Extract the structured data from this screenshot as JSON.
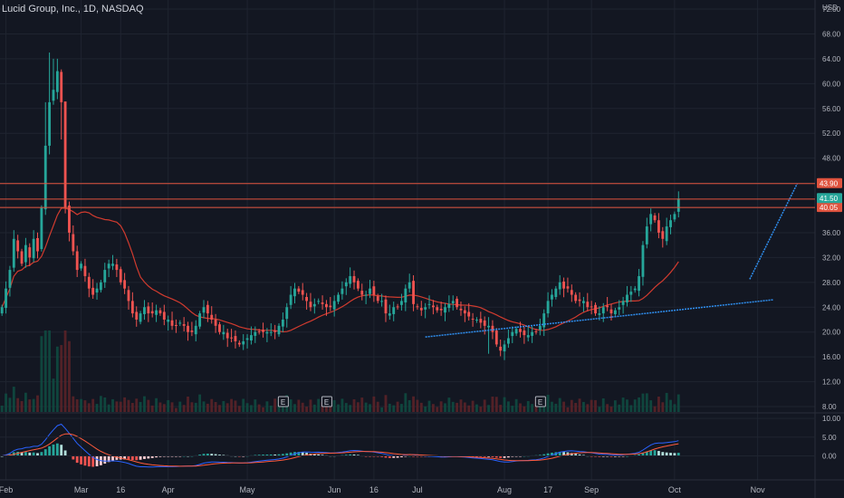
{
  "header": {
    "title": "Lucid Group, Inc., 1D, NASDAQ",
    "currency": "USD"
  },
  "colors": {
    "background": "#131722",
    "grid": "#1f2430",
    "up": "#26a69a",
    "down": "#ef5350",
    "ma": "#d13b2f",
    "trendline": "#2f8ff0",
    "hline": "#e0533e",
    "macd": "#2962ff",
    "signal": "#ff5a3c"
  },
  "chart_data": [
    {
      "type": "candlestick",
      "title": "Lucid Group, Inc., 1D, NASDAQ",
      "ylabel": "USD",
      "ylim": [
        8,
        72
      ],
      "yticks": [
        "72.00",
        "68.00",
        "64.00",
        "60.00",
        "56.00",
        "52.00",
        "48.00",
        "44.00",
        "40.00",
        "36.00",
        "32.00",
        "28.00",
        "24.00",
        "20.00",
        "16.00",
        "12.00",
        "8.00"
      ],
      "xticks": [
        {
          "label": "Feb",
          "x": 1
        },
        {
          "label": "Mar",
          "x": 20
        },
        {
          "label": "16",
          "x": 30
        },
        {
          "label": "Apr",
          "x": 42
        },
        {
          "label": "May",
          "x": 62
        },
        {
          "label": "Jun",
          "x": 84
        },
        {
          "label": "16",
          "x": 94
        },
        {
          "label": "Jul",
          "x": 105
        },
        {
          "label": "Aug",
          "x": 127
        },
        {
          "label": "17",
          "x": 138
        },
        {
          "label": "Sep",
          "x": 149
        },
        {
          "label": "Oct",
          "x": 170
        },
        {
          "label": "Nov",
          "x": 191
        }
      ],
      "levels": [
        {
          "value": 43.9,
          "label": "43.90"
        },
        {
          "value": 41.4,
          "label": "41.40"
        },
        {
          "value": 40.05,
          "label": "40.05"
        }
      ],
      "last_price": {
        "value": 41.5,
        "label": "41.50"
      },
      "earnings_markers": [
        {
          "x": 71,
          "label": "E"
        },
        {
          "x": 82,
          "label": "E"
        },
        {
          "x": 136,
          "label": "E"
        }
      ],
      "trendlines": [
        {
          "from": [
            107,
            19.2
          ],
          "to": [
            195,
            25.2
          ]
        },
        {
          "from": [
            189,
            28.5
          ],
          "to": [
            201,
            43.9
          ]
        }
      ],
      "closes": [
        24,
        27,
        30,
        35,
        33,
        31,
        34,
        32,
        35,
        33,
        40,
        50,
        57,
        59,
        62,
        57,
        40,
        36,
        33,
        30,
        31,
        29,
        27,
        26,
        27,
        28,
        30,
        31,
        31,
        30,
        28,
        27,
        25,
        23,
        22,
        23,
        24,
        23,
        23,
        23.5,
        23,
        22,
        22,
        21,
        21,
        21.5,
        21,
        20,
        20,
        21,
        23,
        24,
        23,
        22,
        21,
        20,
        20,
        19,
        19,
        18.5,
        18,
        18.5,
        19,
        19.5,
        20,
        20,
        20,
        20,
        20,
        20,
        21,
        22,
        24,
        26,
        27,
        26.5,
        26,
        25,
        24,
        24.5,
        25,
        24.5,
        24,
        24,
        25,
        26,
        27,
        28,
        29,
        28,
        27,
        26,
        26,
        27,
        26,
        25,
        25,
        23,
        23,
        24,
        24,
        25,
        27,
        28,
        24.5,
        24,
        23.5,
        24,
        24.5,
        24,
        23.5,
        23.5,
        24,
        24.5,
        25,
        24,
        23.5,
        23,
        22.5,
        22,
        22,
        21.5,
        21,
        21,
        20,
        18,
        17,
        18,
        19,
        20,
        20.5,
        20,
        19.5,
        19.5,
        20,
        20,
        21,
        23,
        25,
        26,
        27,
        28,
        27,
        27,
        26,
        25,
        25,
        25,
        24,
        24,
        23,
        23,
        24,
        24,
        23,
        23.5,
        24,
        25,
        26,
        26.5,
        27,
        29,
        34,
        37,
        39,
        38,
        36,
        35,
        37,
        38,
        39,
        41.5
      ],
      "ma": [],
      "macd": [],
      "signal": [],
      "histogram": [],
      "macd_yticks": [
        "10.00",
        "5.00",
        "0.00"
      ],
      "macd_ylim": [
        -4,
        11
      ]
    }
  ]
}
